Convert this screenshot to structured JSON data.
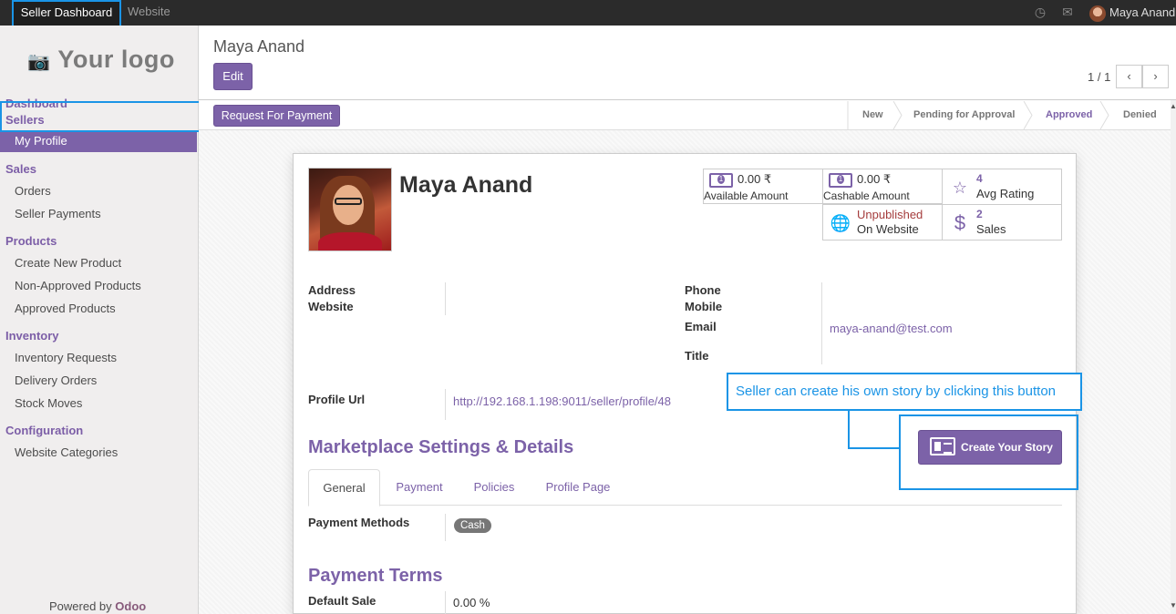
{
  "topbar": {
    "apps": [
      "Seller Dashboard",
      "Website"
    ],
    "icons": [
      "clock-icon",
      "chat-icon"
    ],
    "user_name": "Maya Anand"
  },
  "sidebar": {
    "logo_text": "Your logo",
    "menus": {
      "dashboard": "Dashboard",
      "sellers": "Sellers",
      "my_profile": "My Profile",
      "sales": "Sales",
      "orders": "Orders",
      "seller_payments": "Seller Payments",
      "products": "Products",
      "create_new_product": "Create New Product",
      "non_approved_products": "Non-Approved Products",
      "approved_products": "Approved Products",
      "inventory": "Inventory",
      "inventory_requests": "Inventory Requests",
      "delivery_orders": "Delivery Orders",
      "stock_moves": "Stock Moves",
      "configuration": "Configuration",
      "website_categories": "Website Categories"
    },
    "powered_by": "Powered by",
    "powered_brand": "Odoo"
  },
  "control_panel": {
    "breadcrumb": "Maya Anand",
    "edit_label": "Edit",
    "pager": "1 / 1",
    "prev": "‹",
    "next": "›"
  },
  "statusbar": {
    "request_payment_label": "Request For Payment",
    "stages": [
      "New",
      "Pending for Approval",
      "Approved",
      "Denied"
    ],
    "current_stage": "Approved"
  },
  "profile": {
    "name": "Maya Anand",
    "stats": {
      "available_amount_value": "0.00 ₹",
      "available_amount_label": "Available Amount",
      "cashable_amount_value": "0.00 ₹",
      "cashable_amount_label": "Cashable Amount",
      "avg_rating_value": "4",
      "avg_rating_label": "Avg Rating",
      "website_status": "Unpublished",
      "website_label": "On Website",
      "sales_value": "2",
      "sales_label": "Sales"
    },
    "fields": {
      "address_label": "Address",
      "website_label": "Website",
      "phone_label": "Phone",
      "mobile_label": "Mobile",
      "email_label": "Email",
      "email_value": "maya-anand@test.com",
      "title_label": "Title",
      "profile_url_label": "Profile Url",
      "profile_url_value": "http://192.168.1.198:9011/seller/profile/48"
    },
    "create_story_label": "Create Your Story",
    "marketplace_heading": "Marketplace Settings & Details",
    "tabs": [
      "General",
      "Payment",
      "Policies",
      "Profile Page"
    ],
    "payment_methods_label": "Payment Methods",
    "payment_method_tag": "Cash",
    "payment_terms_heading": "Payment Terms",
    "default_sale_label": "Default Sale",
    "default_sale_value": "0.00 %"
  },
  "annotation": {
    "callout_text": "Seller can create his own story by clicking this button",
    "color": "#1a94e6"
  },
  "colors": {
    "brand_purple": "#7c62a8",
    "topbar": "#2b2b2b"
  }
}
